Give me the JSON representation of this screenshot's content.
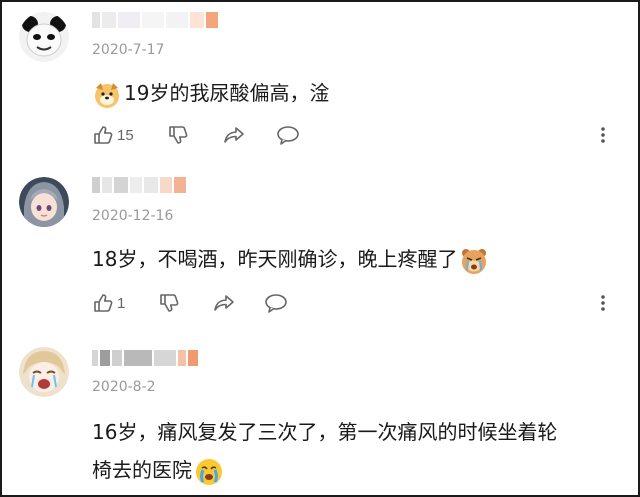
{
  "comments": [
    {
      "date": "2020-7-17",
      "text": "19岁的我尿酸偏高，淦",
      "likes": "15",
      "avatar_icon": "panda-meme-avatar-icon",
      "content_icon": "dog-face-emoji-icon"
    },
    {
      "date": "2020-12-16",
      "text": "18岁，不喝酒，昨天刚确诊，晚上疼醒了",
      "likes": "1",
      "avatar_icon": "anime-girl-avatar-icon",
      "content_icon": "crying-bear-emoji-icon"
    },
    {
      "date": "2020-8-2",
      "text_line1": "16岁，痛风复发了三次了，第一次痛风的时候坐着轮",
      "text_line2": "椅去的医院",
      "likes": "",
      "avatar_icon": "crying-anime-avatar-icon",
      "content_icon": "crying-face-emoji-icon"
    }
  ],
  "action_icons": [
    "thumbs-up-icon",
    "thumbs-down-icon",
    "share-icon",
    "reply-icon",
    "more-icon"
  ],
  "colors": {
    "text": "#1a1a1a",
    "meta": "#9a9a9a",
    "icon": "#666666"
  }
}
